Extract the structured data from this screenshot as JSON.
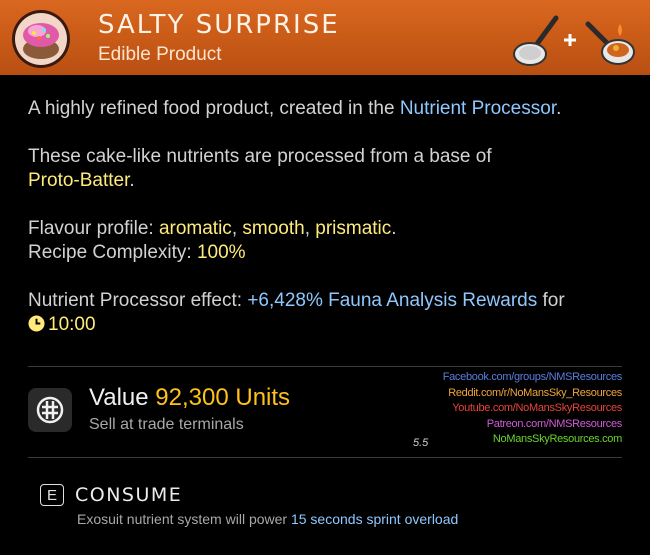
{
  "header": {
    "title": "SALTY SURPRISE",
    "subtitle": "Edible Product",
    "item_icon": "cake-icon",
    "craft_icons": [
      "frying-pan-icon",
      "plus-icon",
      "cooking-pan-icon"
    ],
    "color": "#d0611b"
  },
  "description": {
    "p1_text": "A highly refined food product, created in the ",
    "p1_link": "Nutrient Processor",
    "p1_end": ".",
    "p2_text": "These cake-like nutrients are processed from a base of",
    "p2_link": "Proto-Batter",
    "p2_end": ".",
    "flavour_label": "Flavour profile: ",
    "flavours": [
      "aromatic",
      "smooth",
      "prismatic"
    ],
    "flavour_sep1": ", ",
    "flavour_sep2": ", ",
    "flavour_end": ".",
    "complexity_label": "Recipe Complexity: ",
    "complexity_value": "100%",
    "effect_label": "Nutrient Processor effect: ",
    "effect_value": "+6,428% Fauna Analysis Rewards",
    "effect_for": " for",
    "duration_icon": "clock-icon",
    "duration": "10:00"
  },
  "value": {
    "icon": "units-icon",
    "label": "Value ",
    "amount": "92,300 Units",
    "sub": "Sell at trade terminals"
  },
  "links": [
    {
      "text": "Facebook.com/groups/NMSResources",
      "color": "#5b7de0"
    },
    {
      "text": "Reddit.com/r/NoMansSky_Resources",
      "color": "#f0a43a"
    },
    {
      "text": "Youtube.com/NoMansSkyResources",
      "color": "#e8453c"
    },
    {
      "text": "Patreon.com/NMSResources",
      "color": "#d25bd8"
    },
    {
      "text": "NoMansSkyResources.com",
      "color": "#6cd42e"
    }
  ],
  "version": "5.5",
  "action": {
    "key": "E",
    "label": "CONSUME",
    "desc": "Exosuit nutrient system will power ",
    "desc_highlight": "15 seconds sprint overload"
  },
  "colors": {
    "accent_blue": "#8ec8ff",
    "accent_yellow": "#ffeb7a",
    "units": "#ffc21a"
  }
}
